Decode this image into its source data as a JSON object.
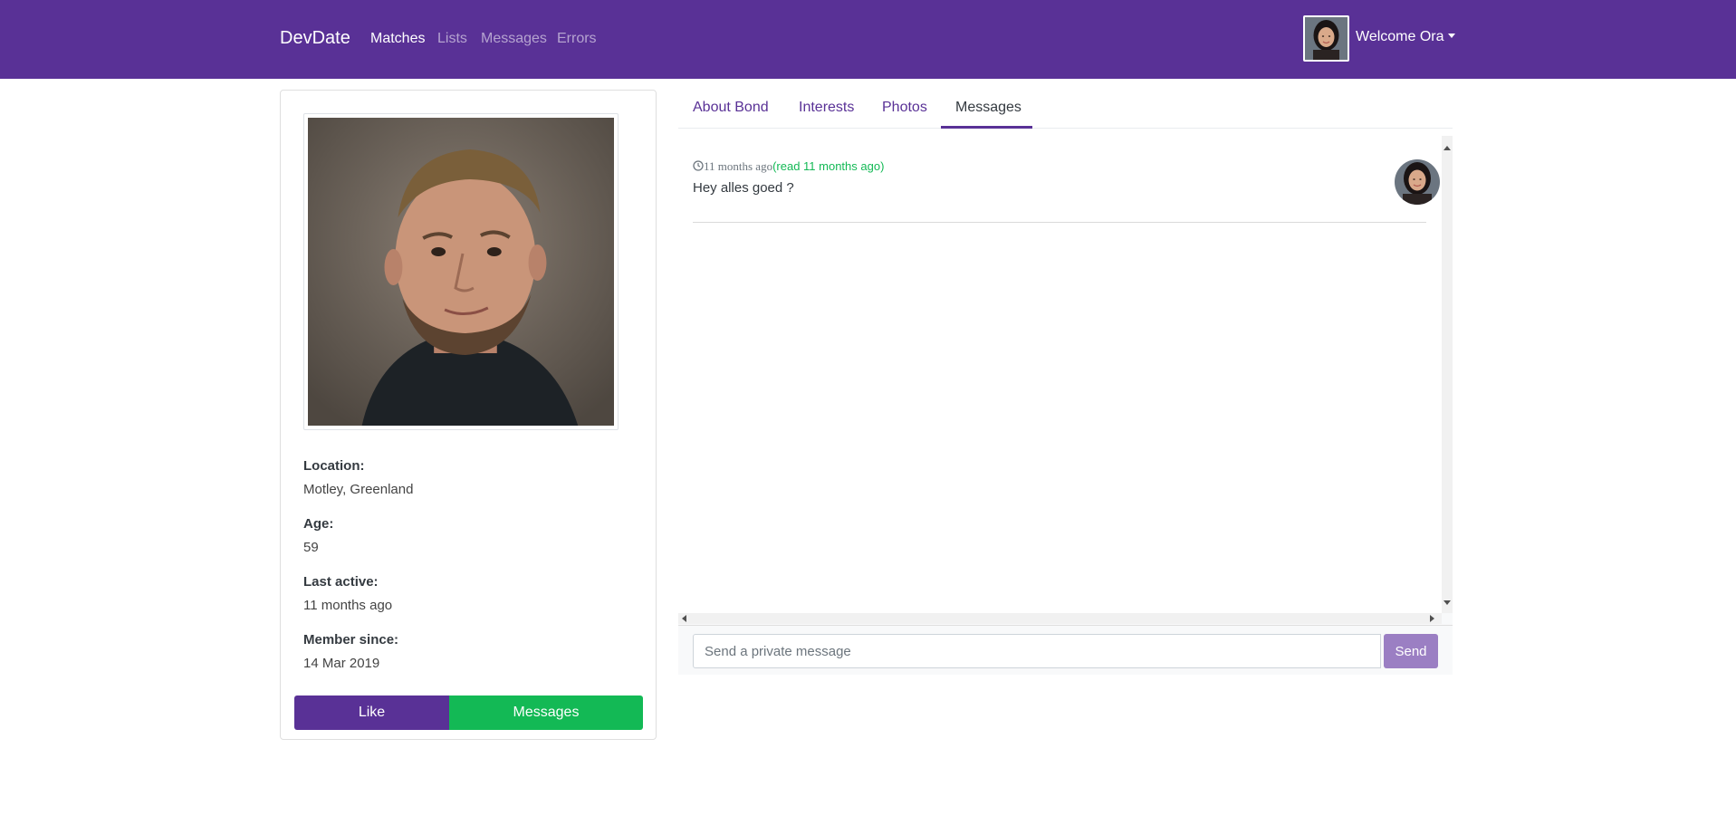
{
  "navbar": {
    "brand": "DevDate",
    "links": [
      {
        "label": "Matches",
        "active": true
      },
      {
        "label": "Lists",
        "active": false
      },
      {
        "label": "Messages",
        "active": false
      },
      {
        "label": "Errors",
        "active": false
      }
    ],
    "welcome": "Welcome Ora",
    "dropdown_icon": "caret-down-icon",
    "avatar_icon": "user-avatar"
  },
  "profile": {
    "photo": "profile-photo",
    "fields": [
      {
        "label": "Location:",
        "value": "Motley, Greenland"
      },
      {
        "label": "Age:",
        "value": "59"
      },
      {
        "label": "Last active:",
        "value": "11 months ago"
      },
      {
        "label": "Member since:",
        "value": "14 Mar 2019"
      }
    ],
    "like_button": "Like",
    "messages_button": "Messages"
  },
  "tabs": [
    {
      "label": "About Bond",
      "active": false
    },
    {
      "label": "Interests",
      "active": false
    },
    {
      "label": "Photos",
      "active": false
    },
    {
      "label": "Messages",
      "active": true
    }
  ],
  "messages": {
    "items": [
      {
        "time": "11 months ago",
        "read_status": "(read 11 months ago)",
        "text": "Hey alles goed ?",
        "clock_icon": "clock-icon"
      }
    ],
    "input_placeholder": "Send a private message",
    "send_label": "Send"
  },
  "colors": {
    "primary": "#593196",
    "success": "#13b955",
    "send_button": "#9b7fc3"
  }
}
